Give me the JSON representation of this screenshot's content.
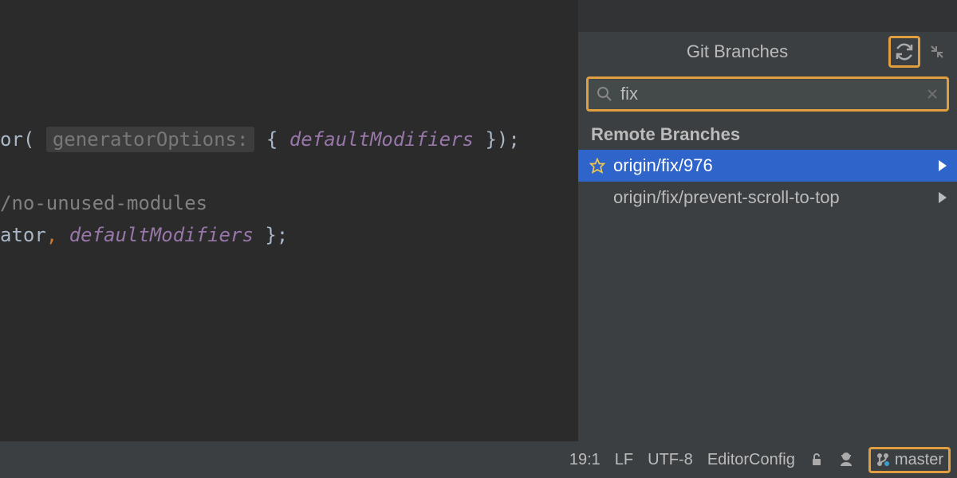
{
  "popup": {
    "title": "Git Branches",
    "search_value": "fix",
    "section_label": "Remote Branches",
    "branches": [
      {
        "name": "origin/fix/976",
        "starred": true,
        "selected": true
      },
      {
        "name": "origin/fix/prevent-scroll-to-top",
        "starred": false,
        "selected": false
      }
    ]
  },
  "editor": {
    "line1_pre": "or(",
    "line1_hint": "generatorOptions:",
    "line1_brace_open": " { ",
    "line1_prop": "defaultModifiers",
    "line1_brace_close": " });",
    "line2": "/no-unused-modules",
    "line3_a": "ator",
    "line3_comma": ", ",
    "line3_prop": "defaultModifiers",
    "line3_end": " };"
  },
  "status": {
    "position": "19:1",
    "line_sep": "LF",
    "encoding": "UTF-8",
    "editorconfig": "EditorConfig",
    "branch": "master"
  },
  "colors": {
    "highlight": "#e09e3f",
    "selection": "#2f65ca"
  }
}
